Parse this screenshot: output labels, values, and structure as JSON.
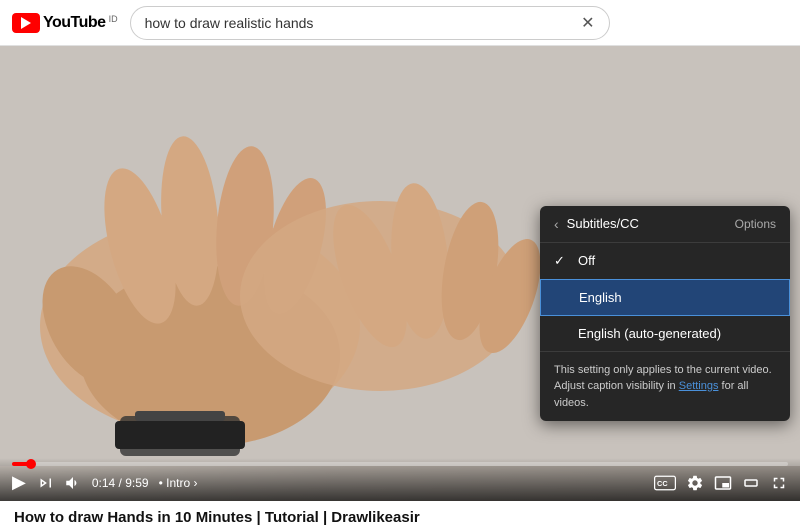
{
  "header": {
    "logo_text": "YouTube",
    "logo_badge": "ID",
    "search_value": "how to draw realistic hands",
    "clear_icon": "✕"
  },
  "video": {
    "progress_percent": 2.4,
    "time_current": "0:14",
    "time_total": "9:59",
    "chapter": "Intro",
    "title": "How to draw Hands in 10 Minutes | Tutorial | Drawlikeasir"
  },
  "controls": {
    "play_icon": "▶",
    "skip_icon": "⏭",
    "volume_icon": "🔊",
    "subtitles_icon": "CC",
    "settings_icon": "⚙",
    "miniplayer_icon": "⊡",
    "theater_icon": "▭",
    "fullscreen_icon": "⤢"
  },
  "subtitles_popup": {
    "back_arrow": "‹",
    "title": "Subtitles/CC",
    "options_label": "Options",
    "items": [
      {
        "id": "off",
        "label": "Off",
        "checked": true,
        "selected": false
      },
      {
        "id": "english",
        "label": "English",
        "checked": false,
        "selected": true
      },
      {
        "id": "english-auto",
        "label": "English (auto-generated)",
        "checked": false,
        "selected": false
      }
    ],
    "note_text": "This setting only applies to the current video. Adjust caption visibility in ",
    "note_link": "Settings",
    "note_suffix": " for all videos."
  }
}
